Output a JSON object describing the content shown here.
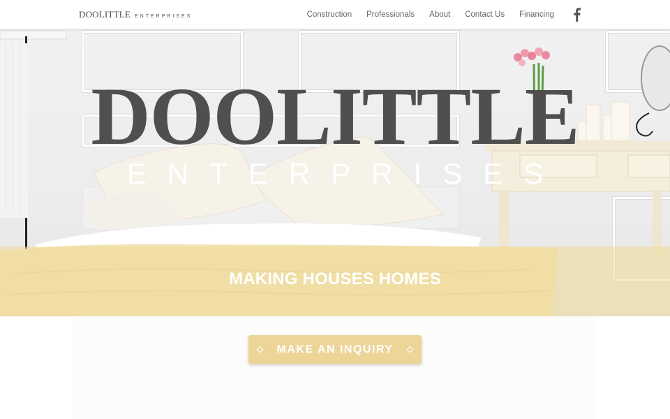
{
  "header": {
    "logo_main": "DOOLITTLE",
    "logo_sub": "ENTERPRISES",
    "nav": [
      "Construction",
      "Professionals",
      "About",
      "Contact Us",
      "Financing"
    ],
    "social_icon": "facebook-icon"
  },
  "hero": {
    "title": "DOOLITTLE",
    "subtitle": "ENTERPRISES",
    "tagline": "MAKING HOUSES HOMES",
    "band_color": "#eedb96"
  },
  "cta": {
    "label": "MAKE AN INQUIRY",
    "color": "#ecd597"
  },
  "colors": {
    "title_gray": "#4f4f4f",
    "nav_text": "#666666"
  }
}
